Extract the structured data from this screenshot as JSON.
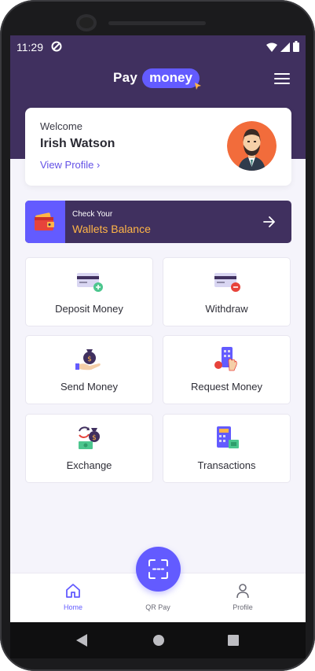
{
  "status_bar": {
    "time": "11:29"
  },
  "app": {
    "logo_pay": "Pay",
    "logo_money": "money",
    "accent_color": "#635bff",
    "header_color": "#40305f",
    "highlight_color": "#ffb547"
  },
  "profile": {
    "welcome": "Welcome",
    "name": "Irish Watson",
    "view_profile": "View Profile ›"
  },
  "wallet_banner": {
    "subtitle": "Check Your",
    "title": "Wallets Balance"
  },
  "actions": [
    {
      "label": "Deposit Money",
      "icon": "deposit-card-icon"
    },
    {
      "label": "Withdraw",
      "icon": "withdraw-card-icon"
    },
    {
      "label": "Send Money",
      "icon": "money-bag-hand-icon"
    },
    {
      "label": "Request Money",
      "icon": "phone-request-icon"
    },
    {
      "label": "Exchange",
      "icon": "exchange-icon"
    },
    {
      "label": "Transactions",
      "icon": "calculator-icon"
    }
  ],
  "bottom_nav": {
    "home": "Home",
    "qr": "QR Pay",
    "profile": "Profile"
  }
}
